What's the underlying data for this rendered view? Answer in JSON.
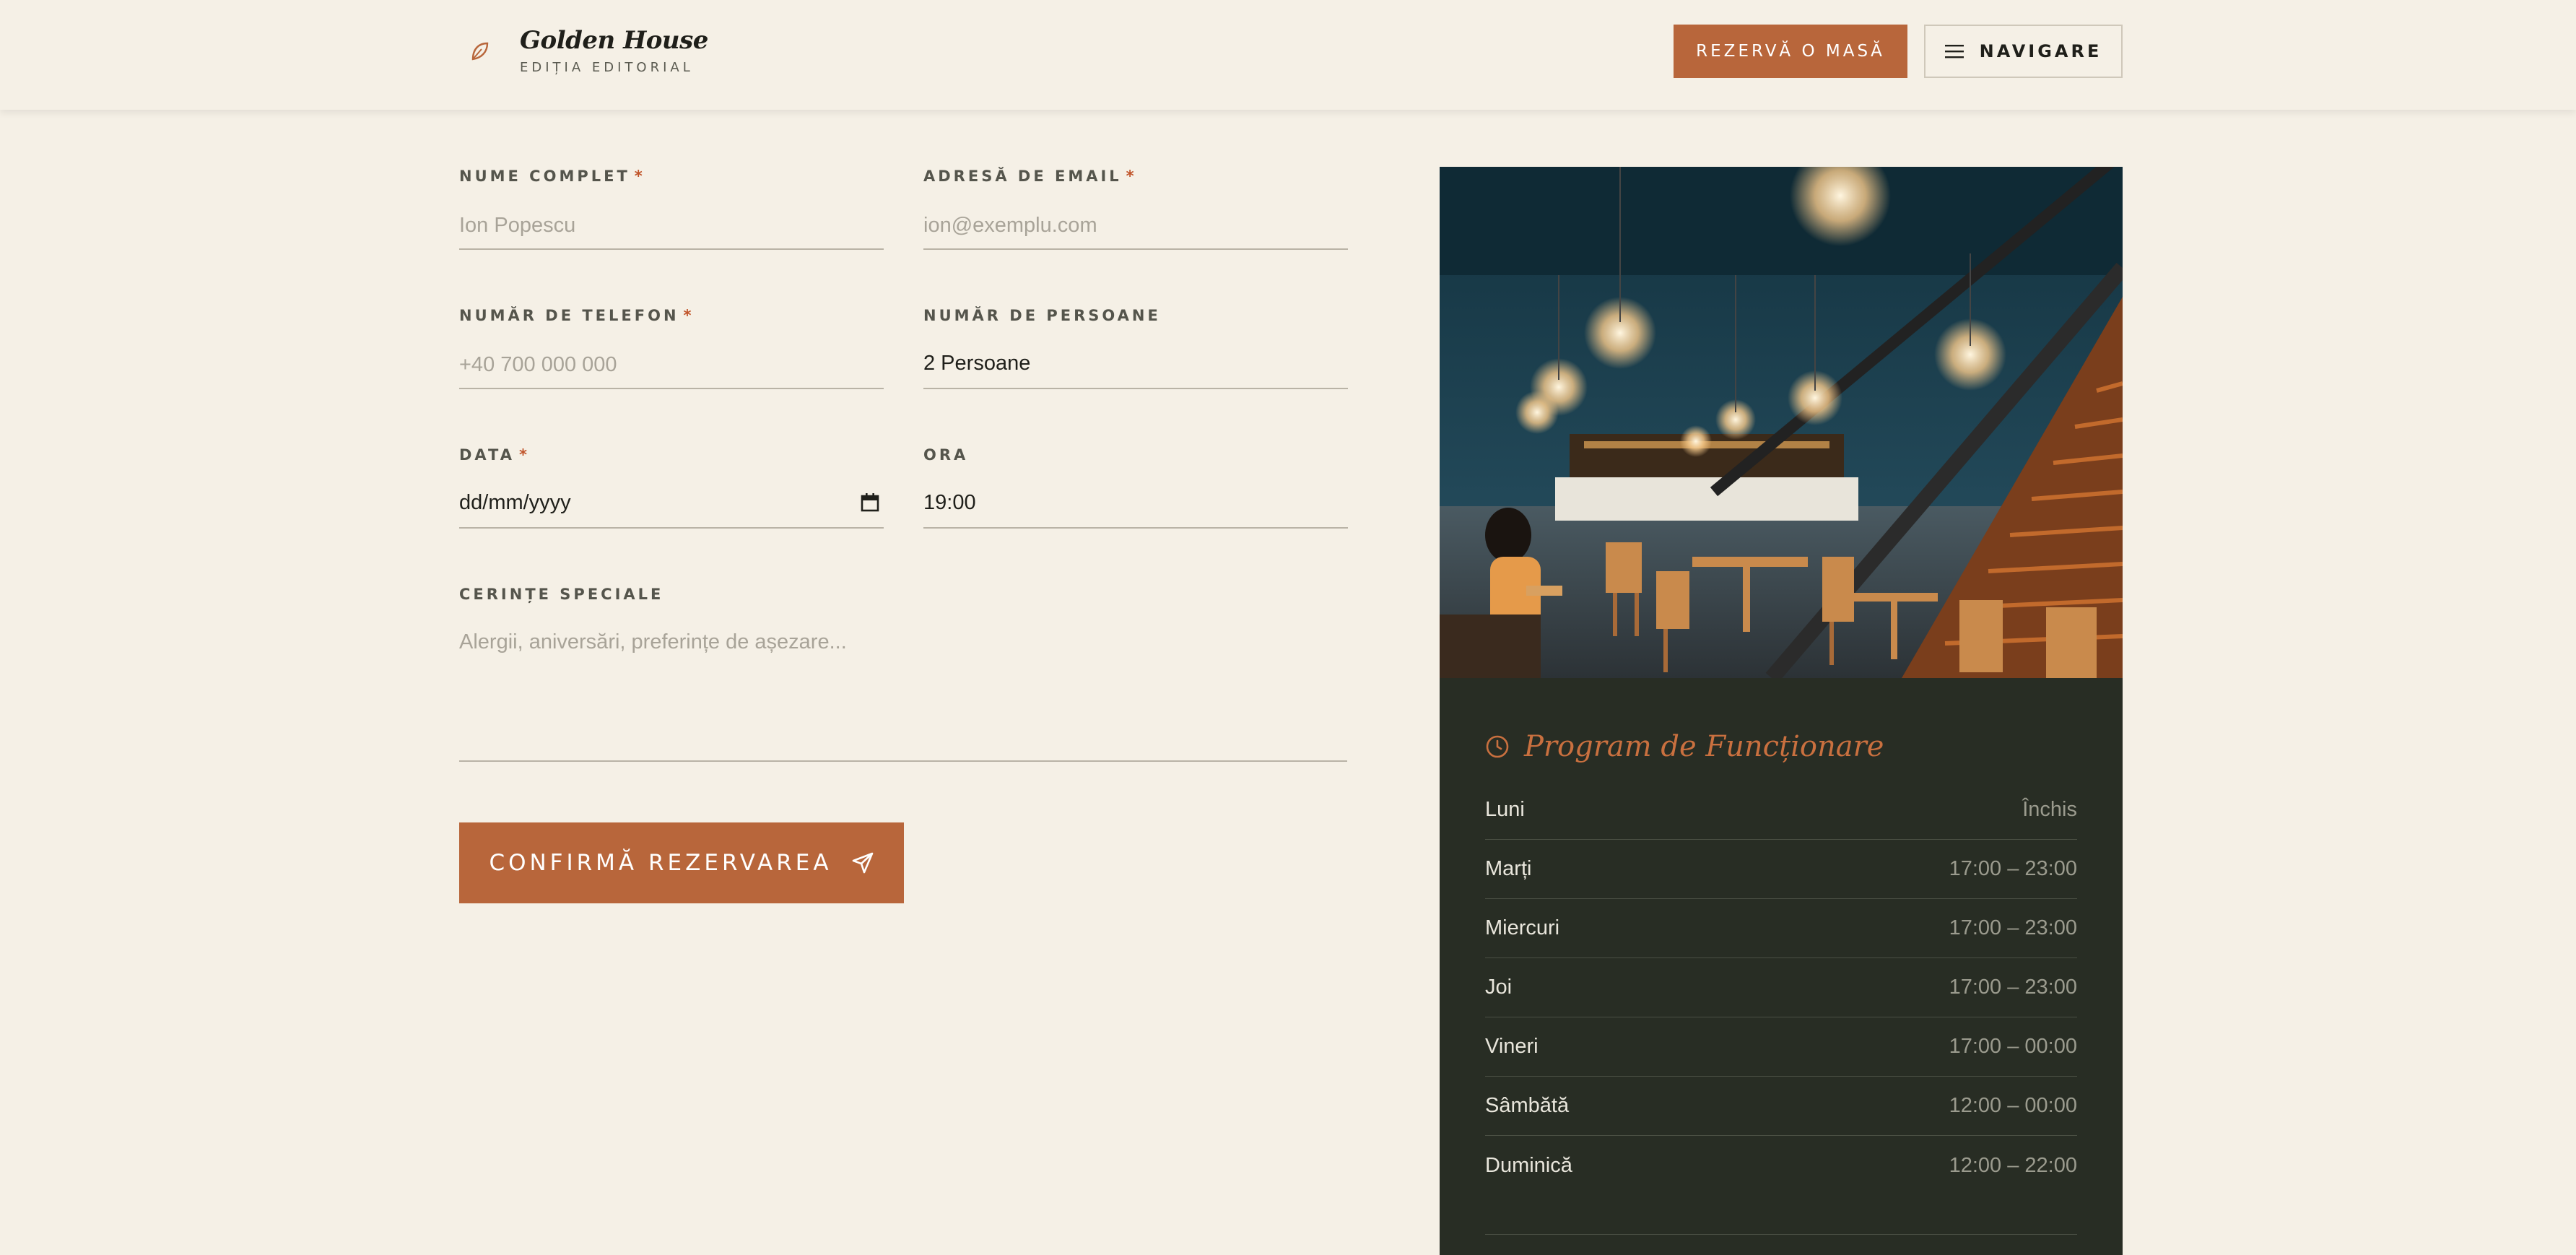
{
  "header": {
    "brand_title": "Golden House",
    "brand_subtitle": "EDIȚIA EDITORIAL",
    "reserve_label": "REZERVĂ O MASĂ",
    "nav_label": "NAVIGARE"
  },
  "form": {
    "name": {
      "label": "NUME COMPLET",
      "required": "*",
      "placeholder": "Ion Popescu"
    },
    "email": {
      "label": "ADRESĂ DE EMAIL",
      "required": "*",
      "placeholder": "ion@exemplu.com"
    },
    "phone": {
      "label": "NUMĂR DE TELEFON",
      "required": "*",
      "placeholder": "+40 700 000 000"
    },
    "guests": {
      "label": "NUMĂR DE PERSOANE",
      "value": "2 Persoane"
    },
    "date": {
      "label": "DATA",
      "required": "*",
      "value": "dd/mm/yyyy"
    },
    "time": {
      "label": "ORA",
      "value": "19:00"
    },
    "special": {
      "label": "CERINȚE SPECIALE",
      "placeholder": "Alergii, aniversări, preferințe de așezare..."
    },
    "submit_label": "CONFIRMĂ REZERVAREA"
  },
  "hours": {
    "title": "Program de Funcționare",
    "rows": [
      {
        "day": "Luni",
        "time": "Închis"
      },
      {
        "day": "Marți",
        "time": "17:00 – 23:00"
      },
      {
        "day": "Miercuri",
        "time": "17:00 – 23:00"
      },
      {
        "day": "Joi",
        "time": "17:00 – 23:00"
      },
      {
        "day": "Vineri",
        "time": "17:00 – 00:00"
      },
      {
        "day": "Sâmbătă",
        "time": "12:00 – 00:00"
      },
      {
        "day": "Duminică",
        "time": "12:00 – 22:00"
      }
    ]
  },
  "colors": {
    "background": "#f5f0e6",
    "accent": "#b8663b",
    "panel": "#282d24",
    "required": "#c0542a"
  },
  "icons": {
    "brand": "leaf-icon",
    "nav": "menu-icon",
    "submit": "send-icon",
    "hours": "clock-icon",
    "date": "calendar-icon"
  }
}
